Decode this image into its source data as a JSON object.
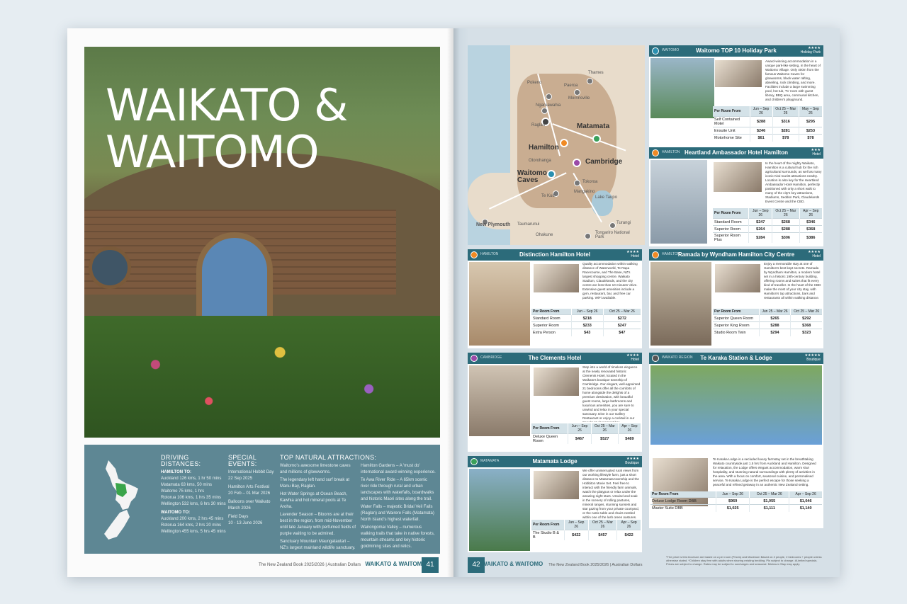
{
  "left": {
    "title_line1": "WAIKATO &",
    "title_line2": "WAITOMO",
    "driving": {
      "heading": "DRIVING DISTANCES:",
      "hamilton_label": "HAMILTON TO:",
      "hamilton": [
        "Auckland 126 kms, 1 hr 50 mins",
        "Matamata 63 kms, 50 mins",
        "Waitomo 75 kms, 1 hrs",
        "Rotorua 106 kms, 1 hrs 35 mins",
        "Wellington 532 kms, 6 hrs 30 mins"
      ],
      "waitomo_label": "WAITOMO TO:",
      "waitomo": [
        "Auckland 200 kms, 2 hrs 45 mins",
        "Rotorua 164 kms, 2 hrs 20 mins",
        "Wellington 455 kms, 5 hrs 45 mins"
      ]
    },
    "events": {
      "heading": "SPECIAL EVENTS:",
      "items": [
        {
          "name": "International Hobbit Day",
          "date": "22 Sep 2025"
        },
        {
          "name": "Hamilton Arts Festival",
          "date": "20 Feb – 01 Mar 2026"
        },
        {
          "name": "Balloons over Waikato",
          "date": "March 2026"
        },
        {
          "name": "Field Days",
          "date": "10 - 13 June 2026"
        }
      ]
    },
    "attractions": {
      "heading": "TOP NATURAL ATTRACTIONS:",
      "col1": [
        "Waitomo's awesome limestone caves and millions of glowworms.",
        "The legendary left hand surf break at Manu Bay, Raglan.",
        "Hot Water Springs at Ocean Beach, Kawhia and hot mineral pools at Te Aroha.",
        "Lavender Season – Blooms are at their best in the region, from mid-November until late January with perfumed fields of purple waiting to be admired.",
        "Sanctuary Mountain Maungatautari – NZ's largest mainland wildlife sanctuary."
      ],
      "col2": [
        "Hamilton Gardens – A 'must do' international award-winning experience.",
        "Te Awa River Ride – A 65km scenic river ride through rural and urban landscapes with waterfalls, boardwalks and historic Maori sites along the trail.",
        "Water Falls – majestic Bridal Veil Falls (Raglan) and Wairere Falls (Matamata) North Island's highest waterfall.",
        "Wairongomai Valley – numerous walking trails that take in native forests, mountain streams and key historic goldmining sites and relics."
      ]
    },
    "footer_small": "The New Zealand Book 2025/2026  |  Australian Dollars",
    "footer_title": "WAIKATO & WAITOMO",
    "page_number": "41"
  },
  "map": {
    "big_labels": [
      "Hamilton",
      "Matamata",
      "Cambridge",
      "Otorohanga",
      "Waitomo Caves",
      "New Plymouth"
    ],
    "small_labels": [
      "Thames",
      "Pokeno",
      "Paeroa",
      "Morrinsville",
      "Ngaruawahia",
      "Raglan",
      "Tokoroa",
      "Mangakino",
      "Te Kuiti",
      "Lake Taupo",
      "Taumarunui",
      "Turangi",
      "Ohakune",
      "Tongariro National Park"
    ]
  },
  "cards": [
    {
      "region": "WAITOMO",
      "name": "Waitomo TOP 10 Holiday Park",
      "stars": "★★★★",
      "type": "Holiday Park",
      "color": "#2a8fb0",
      "desc": "Award-winning accommodation in a unique park-like setting, in the heart of Waitomo Village. Only 400m from the famous Waitomo Caves for glowworms, black water rafting, abseiling, rock climbing, and more. Facilities include a large swimming pool, hot tub, TV room with guest library, BBQ area, communal kitchen, and children's playground.",
      "cols": [
        "Per Room From",
        "Jun – Sep 26",
        "Oct 25 – Mar 26",
        "May – Sep 26"
      ],
      "rows": [
        [
          "Self Contained Motel",
          "$288",
          "$316",
          "$295"
        ],
        [
          "Ensuite Unit",
          "$246",
          "$281",
          "$253"
        ],
        [
          "Motorhome Site",
          "$61",
          "$78",
          "$78"
        ]
      ]
    },
    {
      "region": "HAMILTON",
      "name": "Heartland Ambassador Hotel Hamilton",
      "stars": "★★★",
      "type": "Hotel",
      "color": "#f08a24",
      "desc": "In the heart of the mighty Waikato, Hamilton is a cultural hub for the rich agricultural surrounds, as well as many iconic Kiwi tourist attractions nearby. Location is also key for the Heartland Ambassador Hotel Hamilton, perfectly positioned with only a short walk to many of the city's key attractions, Stadiums, Seddon Park, Claudelands Event Centre and the CBD.",
      "cols": [
        "Per Room From",
        "Jun – Sep 26",
        "Oct 25 – Mar 26",
        "Apr – Sep 26"
      ],
      "rows": [
        [
          "Standard Room",
          "$247",
          "$268",
          "$346"
        ],
        [
          "Superior Room",
          "$264",
          "$288",
          "$368"
        ],
        [
          "Superior Room Plus",
          "$284",
          "$306",
          "$386"
        ]
      ]
    },
    {
      "region": "HAMILTON",
      "name": "Distinction Hamilton Hotel",
      "stars": "★★★★",
      "type": "Hotel",
      "color": "#f08a24",
      "desc": "Quality accommodation within walking distance of Waterworld, Te Rapa Racecourse, and The Base, NZ's largest shopping centre. Waikato Stadium, Claudelands, and the city centre are less than 10 minutes' drive. Extensive guest amenities include a gym, restaurant, bar, and free car parking. WiFi available.",
      "cols": [
        "Per Room From",
        "Jun – Sep 26",
        "Oct 25 – Mar 26"
      ],
      "rows": [
        [
          "Standard Room",
          "$218",
          "$272"
        ],
        [
          "Superior Room",
          "$233",
          "$247"
        ],
        [
          "Extra Person",
          "$43",
          "$47"
        ]
      ]
    },
    {
      "region": "HAMILTON",
      "name": "Ramada by Wyndham Hamilton City Centre",
      "stars": "★★★★",
      "type": "Hotel",
      "color": "#f08a24",
      "desc": "Enjoy a memorable stay at one of Hamilton's best kept secrets. Ramada by Wyndham Hamilton, a modern hotel set in a historic 19th-century building, offering rooms and suites that fit every kind of traveller. In the heart of the CBD make the most of your city stay, with Hamilton's top attractions, bars and restaurants all within walking distance.",
      "cols": [
        "Per Room From",
        "Jun 25 – Mar 26",
        "Oct 25 – Mar 26"
      ],
      "rows": [
        [
          "Superior Queen Room",
          "$265",
          "$292"
        ],
        [
          "Superior King Room",
          "$288",
          "$368"
        ],
        [
          "Studio Room Twin",
          "$294",
          "$323"
        ]
      ]
    },
    {
      "region": "CAMBRIDGE",
      "name": "The Clements Hotel",
      "stars": "★★★★",
      "type": "Hotel",
      "color": "#9a4aa8",
      "desc": "Step into a world of timeless elegance at the newly renovated historic Clements Hotel, located in the Waikato's boutique township of Cambridge. Our elegant, well-appointed 21 bedrooms offer all the comforts of home alongside the delights of a premium destination, with beautiful guest rooms, large bathrooms and luxurious amenities, you are sure to unwind and relax in your special sanctuary. Dine in our Gallery Restaurant or enjoy a cocktail in our Speakeasy basement bar.",
      "cols": [
        "Per Room From",
        "Jun – Sep 26",
        "Oct 25 – Mar 26",
        "Apr – Sep 26"
      ],
      "rows": [
        [
          "Deluxe Queen Room",
          "$467",
          "$527",
          "$489"
        ]
      ]
    },
    {
      "region": "WAIKATO REGION",
      "name": "Te Karaka Station & Lodge",
      "stars": "★★★★★",
      "type": "Boutique",
      "color": "#555555",
      "desc": "Te Karaka Lodge is a secluded luxury farmstay set in the breathtaking Waikato countryside just 1.5 hrs from Auckland and Hamilton. Designed for relaxation, the Lodge offers elegant accommodation, warm Kiwi hospitality, and stunning natural surroundings with plenty of activities in the area. With a focus on comfort, seasonal cuisine, and personalised service, Te Karaka Lodge is the perfect escape for those seeking a peaceful and refined getaway in an authentic New Zealand setting.",
      "cols": [
        "Per Room From",
        "Jun – Sep 26",
        "Oct 25 – Mar 26",
        "Apr – Sep 26"
      ],
      "rows": [
        [
          "Deluxe Lodge Room DBB",
          "$969",
          "$1,055",
          "$1,046"
        ],
        [
          "Master Suite DBB",
          "$1,025",
          "$1,111",
          "$1,140"
        ]
      ]
    },
    {
      "region": "MATAMATA",
      "name": "Matamata Lodge",
      "stars": "★★★★",
      "type": "Boutique",
      "color": "#3aa05a",
      "desc": "We offer uninterrupted rural views from our working lifestyle farm, just a short distance to Matamata township and the Hobbiton Movie Set. Feel free to interact with the friendly farm animals, watch the platypus or relax under the amazing night stars. Unwind and soak in the scenery of rolling pastures, mineral ranges, stunning sunsets and star gazing from your private courtyard, or the rustic table and chairs nestled within one of the lush green pastures.",
      "cols": [
        "Per Room From",
        "Jun – Sep 26",
        "Oct 25 – Mar 26",
        "Apr – Sep 26"
      ],
      "rows": [
        [
          "The Studio B & B",
          "$422",
          "$457",
          "$422"
        ]
      ]
    }
  ],
  "right": {
    "page_number": "42",
    "footer_title": "WAIKATO & WAITOMO",
    "footer_small": "The New Zealand Book 2025/2026  |  Australian Dollars",
    "fine_print": "*The price is this brochure are based on a per room (Prices) and Maximum Based on 2 people, 2 bedrooms + people unless otherwise stated. *Children stay free with adults when sharing existing bedding. Pls subject to change. #Limited specials. Prices are subject to change. Rates may be subject to surcharges and seasonal. Minimum Stay may apply."
  }
}
